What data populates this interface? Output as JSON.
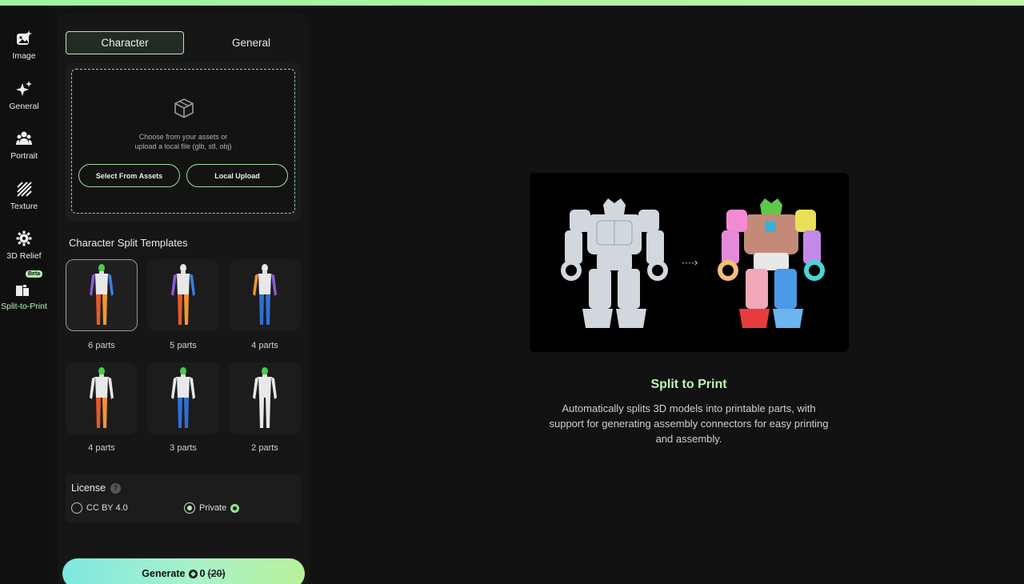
{
  "nav": {
    "items": [
      {
        "label": "Image",
        "icon": "image-sparkle-icon"
      },
      {
        "label": "General",
        "icon": "sparkle-icon"
      },
      {
        "label": "Portrait",
        "icon": "people-icon"
      },
      {
        "label": "Texture",
        "icon": "texture-icon"
      },
      {
        "label": "3D Relief",
        "icon": "gear-icon"
      },
      {
        "label": "Split-to-Print",
        "icon": "split-to-print-icon",
        "badge": "Beta",
        "active": true
      }
    ]
  },
  "panel": {
    "tabs": [
      "Character",
      "General"
    ],
    "active_tab": "Character",
    "upload": {
      "hint_line1": "Choose from your assets or",
      "hint_line2": "upload a local file (glb, stl, obj)",
      "select_assets_label": "Select From Assets",
      "local_upload_label": "Local Upload"
    },
    "templates_title": "Character Split Templates",
    "templates": [
      {
        "label": "6 parts",
        "selected": true
      },
      {
        "label": "5 parts",
        "selected": false
      },
      {
        "label": "4 parts",
        "selected": false
      },
      {
        "label": "4 parts",
        "selected": false
      },
      {
        "label": "3 parts",
        "selected": false
      },
      {
        "label": "2 parts",
        "selected": false
      }
    ],
    "license": {
      "title": "License",
      "help": "?",
      "options": [
        "CC BY 4.0",
        "Private"
      ],
      "selected": "Private"
    },
    "generate": {
      "label": "Generate",
      "cost": "0",
      "original_cost": "(20)"
    }
  },
  "main": {
    "title": "Split to Print",
    "description": "Automatically splits 3D models into printable parts, with support for generating assembly connectors for easy printing and assembly."
  },
  "colors": {
    "accent": "#b5f0b0",
    "background": "#121212",
    "panel": "#161616"
  }
}
